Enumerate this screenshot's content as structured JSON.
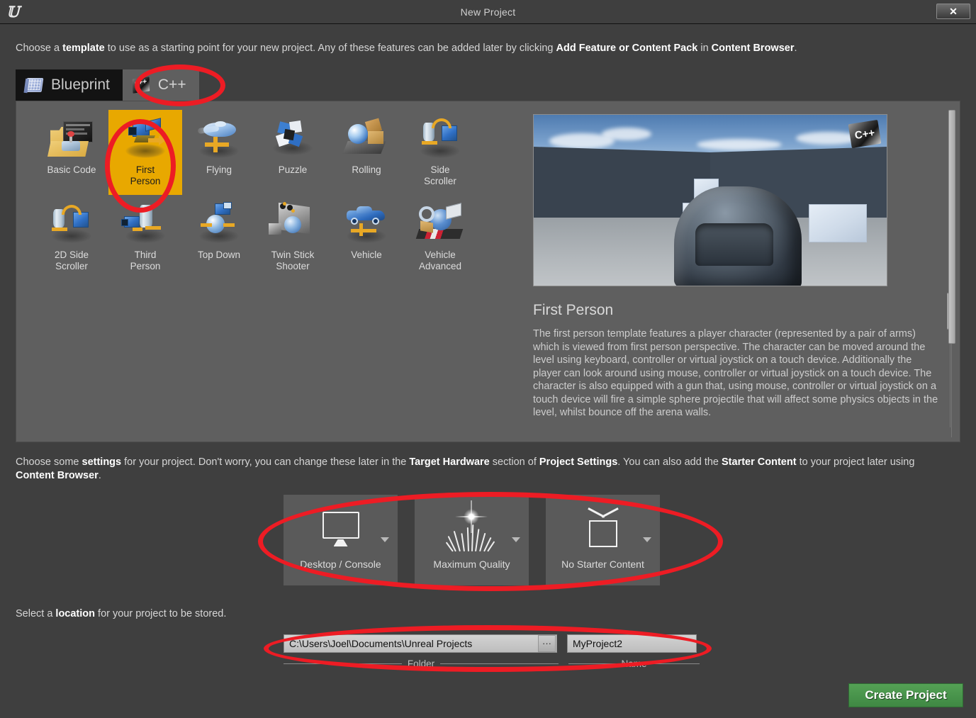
{
  "window": {
    "title": "New Project",
    "logo_icon": "unreal-engine-logo",
    "close_label": "✕"
  },
  "intro": {
    "part1": "Choose a ",
    "bold1": "template",
    "part2": " to use as a starting point for your new project.  Any of these features can be added later by clicking ",
    "bold2": "Add Feature or Content Pack",
    "part3": " in ",
    "bold3": "Content Browser",
    "part4": "."
  },
  "tabs": [
    {
      "label": "Blueprint",
      "icon": "blueprint-book-icon",
      "active": false
    },
    {
      "label": "C++",
      "icon": "cpp-plate-icon",
      "active": true
    }
  ],
  "templates": [
    {
      "label": "Basic Code",
      "icon": "basic-code-icon",
      "selected": false
    },
    {
      "label": "First\nPerson",
      "icon": "first-person-icon",
      "selected": true
    },
    {
      "label": "Flying",
      "icon": "flying-icon",
      "selected": false
    },
    {
      "label": "Puzzle",
      "icon": "puzzle-icon",
      "selected": false
    },
    {
      "label": "Rolling",
      "icon": "rolling-icon",
      "selected": false
    },
    {
      "label": "Side\nScroller",
      "icon": "side-scroller-icon",
      "selected": false
    },
    {
      "label": "2D Side\nScroller",
      "icon": "2d-side-scroller-icon",
      "selected": false
    },
    {
      "label": "Third\nPerson",
      "icon": "third-person-icon",
      "selected": false
    },
    {
      "label": "Top Down",
      "icon": "top-down-icon",
      "selected": false
    },
    {
      "label": "Twin Stick\nShooter",
      "icon": "twin-stick-shooter-icon",
      "selected": false
    },
    {
      "label": "Vehicle",
      "icon": "vehicle-icon",
      "selected": false
    },
    {
      "label": "Vehicle\nAdvanced",
      "icon": "vehicle-advanced-icon",
      "selected": false
    }
  ],
  "preview": {
    "title": "First Person",
    "badge": "C++",
    "description": "The first person template features a player character (represented by a pair of arms) which is viewed from first person perspective. The character can be moved around the level using keyboard, controller or virtual joystick on a touch device. Additionally the player can look around using mouse, controller or virtual joystick on a touch device. The character is also equipped with a gun that, using mouse,  controller or virtual joystick on a touch device will fire a simple sphere projectile that will affect some physics objects in the level, whilst bounce off the arena walls."
  },
  "settings_text": {
    "part1": "Choose some ",
    "bold1": "settings",
    "part2": " for your project.  Don't worry, you can change these later in the ",
    "bold2": "Target Hardware",
    "part3": " section of ",
    "bold3": "Project Settings",
    "part4": ".  You can also add the ",
    "bold4": "Starter Content",
    "part5": " to your project later using ",
    "bold5": "Content Browser",
    "part6": "."
  },
  "settings": [
    {
      "label": "Desktop / Console",
      "icon": "monitor-icon"
    },
    {
      "label": "Maximum Quality",
      "icon": "quality-grass-icon"
    },
    {
      "label": "No Starter Content",
      "icon": "open-box-icon"
    }
  ],
  "location": {
    "part1": "Select a ",
    "bold1": "location",
    "part2": " for your project to be stored.",
    "folder_value": "C:\\Users\\Joel\\Documents\\Unreal Projects",
    "folder_caption": "Folder",
    "browse_label": "···",
    "name_value": "MyProject2",
    "name_caption": "Name"
  },
  "footer": {
    "create_label": "Create Project"
  },
  "colors": {
    "accent_selected": "#e8a800",
    "annotation_red": "#ed1c24",
    "create_green": "#4a9a4e",
    "panel_bg": "#5f5f5f",
    "dialog_bg": "#3f3f3f"
  }
}
